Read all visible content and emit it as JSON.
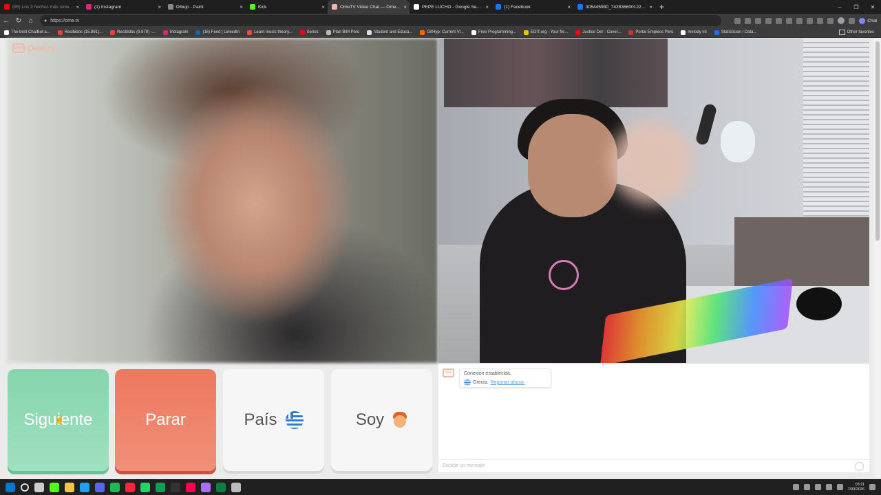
{
  "browser": {
    "tabs": [
      {
        "title": "(85) Los 3 hechos más siniestros q",
        "favicon_color": "#ff0000",
        "active": false,
        "dim": true
      },
      {
        "title": "(1) Instagram",
        "favicon_color": "#d62976",
        "active": false
      },
      {
        "title": "Dibujo - Paint",
        "favicon_color": "#888888",
        "active": false
      },
      {
        "title": "Kick",
        "favicon_color": "#53fc18",
        "active": false
      },
      {
        "title": "OmeTV Video Chat — Omegle",
        "favicon_color": "#f0b7a4",
        "active": true
      },
      {
        "title": "PEPE LUCHO - Google Search",
        "favicon_color": "#ffffff",
        "active": false
      },
      {
        "title": "(1) Facebook",
        "favicon_color": "#1877f2",
        "active": false
      },
      {
        "title": "305445980_742836600122894_58",
        "favicon_color": "#1877f2",
        "active": false
      }
    ],
    "new_tab_icon": "+",
    "url": "https://ome.tv",
    "chat_button": "Chat",
    "bookmarks": [
      {
        "label": "The best ChatBot a...",
        "color": "#ffffff"
      },
      {
        "label": "Recibidos (15.891)...",
        "color": "#ea4335"
      },
      {
        "label": "Recibidos (9.879) -...",
        "color": "#ea4335"
      },
      {
        "label": "Instagram",
        "color": "#d62976"
      },
      {
        "label": "(16) Feed | LinkedIn",
        "color": "#0a66c2"
      },
      {
        "label": "Learn music theory...",
        "color": "#e74c3c"
      },
      {
        "label": "Series",
        "color": "#e50914"
      },
      {
        "label": "Plan BIM Perú",
        "color": "#bbbbbb"
      },
      {
        "label": "Student and Educa...",
        "color": "#dddddd"
      },
      {
        "label": "GitHyp: Current Vi...",
        "color": "#ff6a00"
      },
      {
        "label": "Free Programming...",
        "color": "#ffffff"
      },
      {
        "label": "EDIT.org - Your fre...",
        "color": "#f2c200"
      },
      {
        "label": "Justice Der - Cover...",
        "color": "#ff0000"
      },
      {
        "label": "Portal Empleos Perú",
        "color": "#c0392b"
      },
      {
        "label": "melody ml",
        "color": "#ffffff"
      },
      {
        "label": "Statistician / Data...",
        "color": "#1a73e8"
      }
    ],
    "other_favorites": "Other favorites"
  },
  "site": {
    "logo": "Ome.tv",
    "logo_mark": "Ome"
  },
  "controls": {
    "next": "Siguiente",
    "stop": "Parar",
    "country": "País",
    "gender": "Soy",
    "country_flag_icon": "greece-flag-icon",
    "gender_icon": "boy-face-icon"
  },
  "chat": {
    "status": "Conexión establecida.",
    "country": "Grecia.",
    "report": "Reportar abuso.",
    "input_placeholder": "Escribe un mensaje"
  },
  "taskbar": {
    "apps": [
      "#0078d4",
      "#cccccc",
      "#53fc18",
      "#f4c542",
      "#1da1f2",
      "#5865f2",
      "#1db954",
      "#fa243c",
      "#25d366",
      "#0f9d58",
      "#333333",
      "#ff0050",
      "#a970ff",
      "#107c41",
      "#bbbbbb"
    ],
    "time": "03:11",
    "date": "7/03/2026"
  }
}
